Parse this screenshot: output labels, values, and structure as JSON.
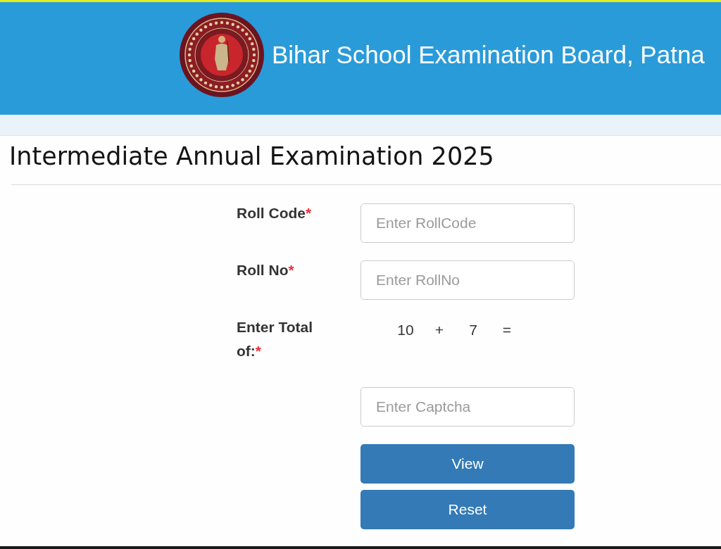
{
  "header": {
    "title": "Bihar School Examination Board, Patna"
  },
  "page": {
    "title": "Intermediate Annual Examination 2025"
  },
  "form": {
    "fields": [
      {
        "kind": "input",
        "label": "Roll Code",
        "required_mark": "*",
        "placeholder": "Enter RollCode"
      },
      {
        "kind": "input",
        "label": "Roll No",
        "required_mark": "*",
        "placeholder": "Enter RollNo"
      },
      {
        "kind": "captcha",
        "label": "Enter Total of:",
        "required_mark": "*",
        "question": {
          "operand_1": "10",
          "operator": "+",
          "operand_2": "7",
          "equals": "="
        },
        "placeholder": "Enter Captcha"
      }
    ],
    "buttons": [
      {
        "label": "View"
      },
      {
        "label": "Reset"
      }
    ]
  }
}
